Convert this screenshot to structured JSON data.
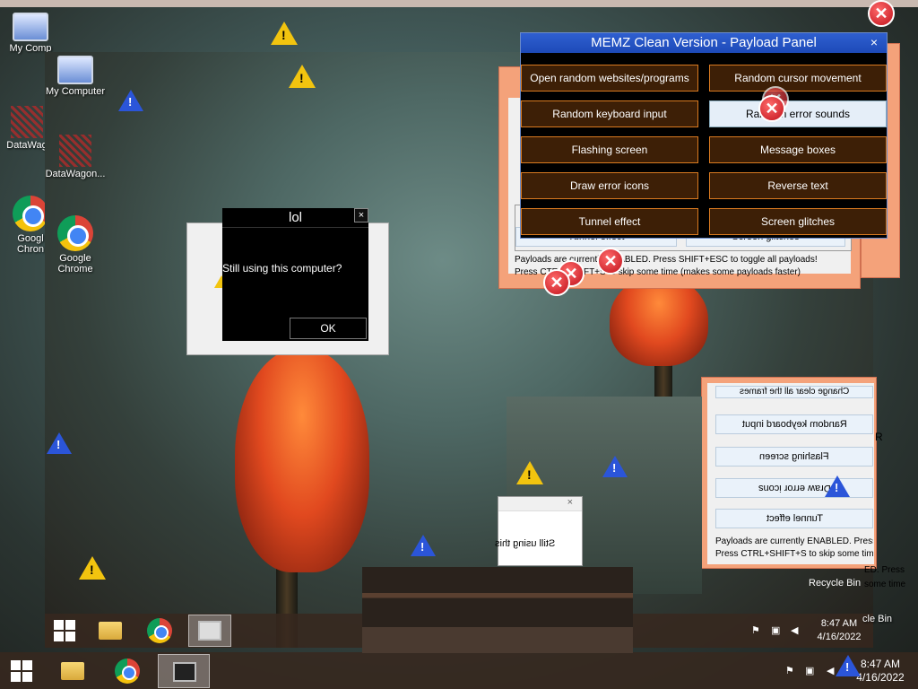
{
  "desktop_outer": {
    "icons": [
      {
        "label": "My Comp"
      },
      {
        "label": "DataWag"
      },
      {
        "label": "Googl Chron"
      }
    ]
  },
  "desktop_inner": {
    "icons": [
      {
        "label": "My Computer"
      },
      {
        "label": "DataWagon..."
      },
      {
        "label": "Google Chrome"
      }
    ],
    "recycle_label": "Recycle Bin",
    "recycle_partial": "cle Bin"
  },
  "memz_panel": {
    "title": "MEMZ Clean Version - Payload Panel",
    "close_label": "×",
    "buttons": [
      {
        "label": "Open random websites/programs"
      },
      {
        "label": "Random cursor movement"
      },
      {
        "label": "Random keyboard input"
      },
      {
        "label": "Random error sounds"
      },
      {
        "label": "Flashing screen"
      },
      {
        "label": "Message boxes"
      },
      {
        "label": "Draw error icons"
      },
      {
        "label": "Reverse text"
      },
      {
        "label": "Tunnel effect"
      },
      {
        "label": "Screen glitches"
      }
    ],
    "behind_buttons": [
      "Tunnel effect",
      "Screen glitches"
    ],
    "status_line1": "Payloads are currently ENABLED. Press SHIFT+ESC to toggle all payloads!",
    "status_line2": "Press CTRL+SHIFT+S to skip some time (makes some payloads faster)"
  },
  "lol_dialog": {
    "title": "lol",
    "close_label": "×",
    "message": "Still using this computer?",
    "ok_label": "OK"
  },
  "mirrored_panel": {
    "buttons": [
      "Random keyboard input",
      "Flashing screen",
      "Draw error icons",
      "Tunnel effect"
    ],
    "top_partial": "Change clear all the frames",
    "side_r": "R",
    "status_line1": "Payloads are currently ENABLED. Press S",
    "status_line2": "Press CTRL+SHIFT+S to skip some time",
    "right_line1": "ED. Press",
    "right_line2": "some time"
  },
  "small_window": {
    "close_label": "×",
    "text": "Still using this"
  },
  "taskbar_outer": {
    "time": "8:47 AM",
    "date": "4/16/2022"
  },
  "taskbar_inner": {
    "time": "8:47 AM",
    "date": "4/16/2022"
  },
  "colors": {
    "memz_button_bg": "#3d1f06",
    "memz_button_border": "#d97a20",
    "memz_title_bg": "#2f5fd0",
    "salmon_frame": "#f4a27a"
  }
}
